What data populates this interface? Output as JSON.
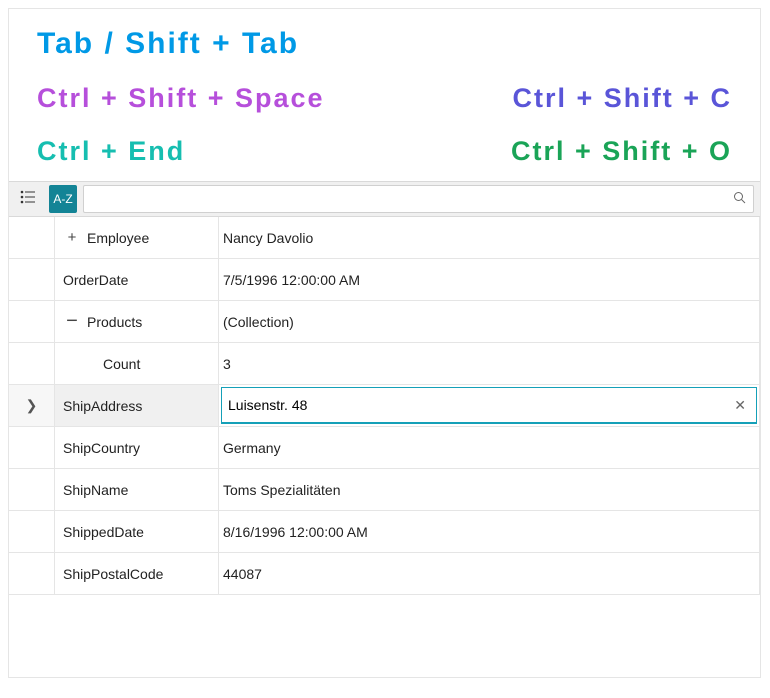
{
  "shortcuts": {
    "tab": "Tab / Shift + Tab",
    "ctrl_shift_c": "Ctrl + Shift + C",
    "ctrl_shift_space": "Ctrl + Shift + Space",
    "ctrl_shift_o": "Ctrl + Shift + O",
    "ctrl_end": "Ctrl + End"
  },
  "toolbar": {
    "az_label": "A-Z",
    "search_value": "",
    "search_placeholder": ""
  },
  "rows": [
    {
      "key": "employee",
      "label": "Employee",
      "value": "Nancy Davolio",
      "expander": "plus",
      "indent": 1
    },
    {
      "key": "orderdate",
      "label": "OrderDate",
      "value": "7/5/1996 12:00:00 AM",
      "indent": 0
    },
    {
      "key": "products",
      "label": "Products",
      "value": "(Collection)",
      "expander": "minus",
      "indent": 1
    },
    {
      "key": "count",
      "label": "Count",
      "value": "3",
      "indent": 2
    },
    {
      "key": "shipaddress",
      "label": "ShipAddress",
      "value": "Luisenstr. 48",
      "indent": 0,
      "active": true,
      "gutter": "chevron"
    },
    {
      "key": "shipcountry",
      "label": "ShipCountry",
      "value": "Germany",
      "indent": 0
    },
    {
      "key": "shipname",
      "label": "ShipName",
      "value": "Toms Spezialitäten",
      "indent": 0
    },
    {
      "key": "shippeddate",
      "label": "ShippedDate",
      "value": "8/16/1996 12:00:00 AM",
      "indent": 0
    },
    {
      "key": "shippostalcode",
      "label": "ShipPostalCode",
      "value": "44087",
      "indent": 0
    }
  ]
}
